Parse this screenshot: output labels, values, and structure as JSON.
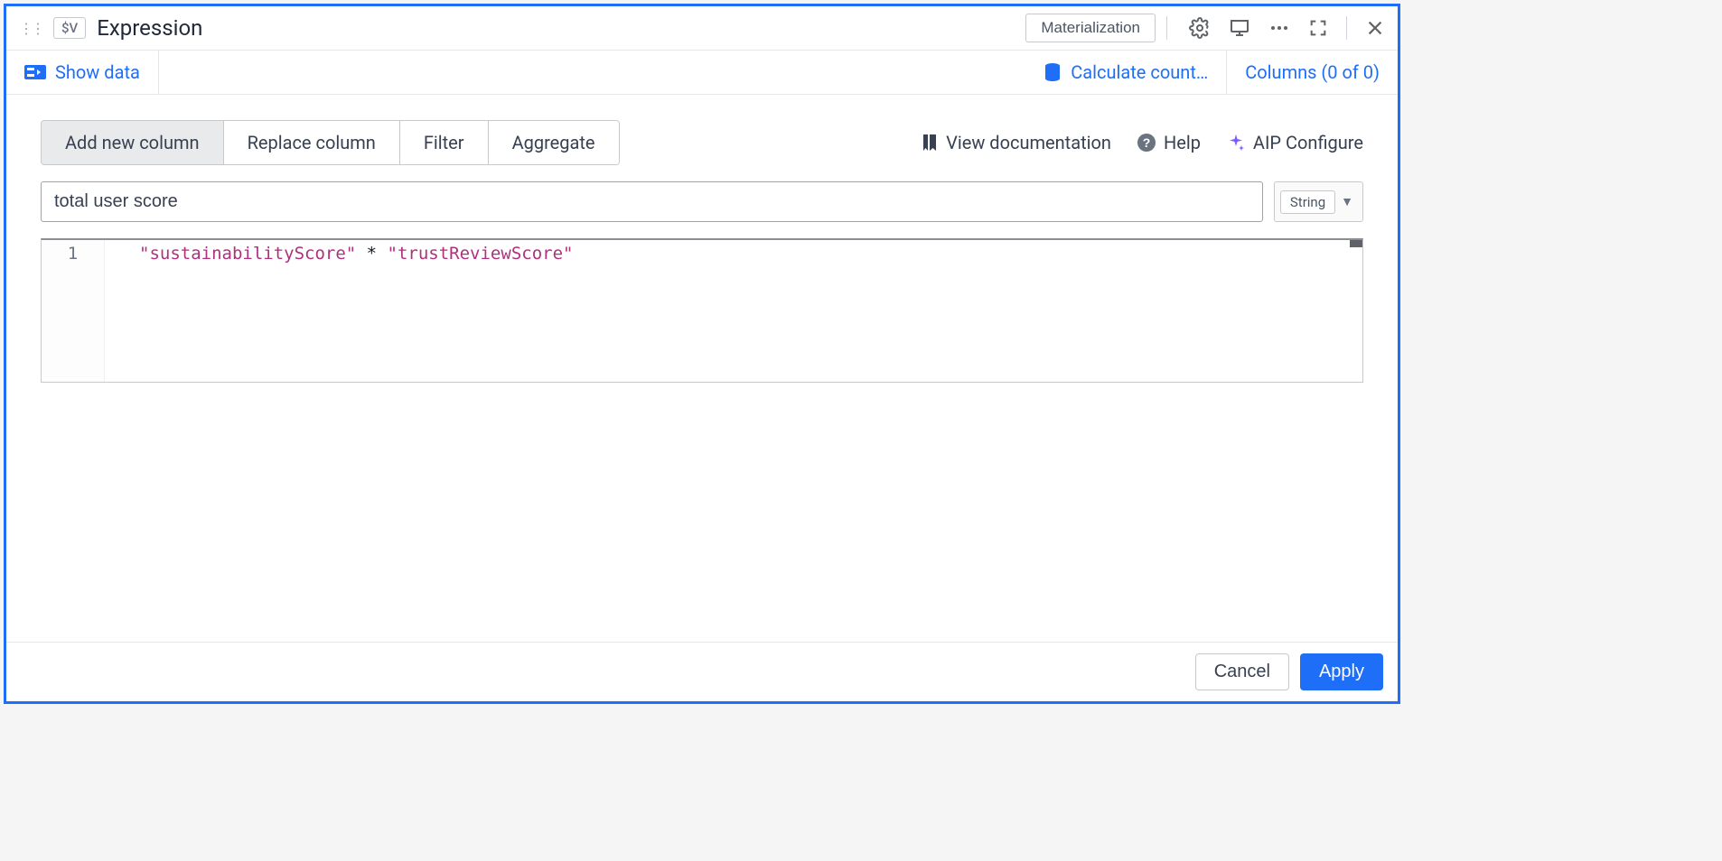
{
  "header": {
    "badge": "$V",
    "title": "Expression",
    "materialization_label": "Materialization"
  },
  "subheader": {
    "show_data_label": "Show data",
    "calc_count_label": "Calculate count…",
    "columns_label": "Columns (0 of 0)"
  },
  "tabs": {
    "add_new_column": "Add new column",
    "replace_column": "Replace column",
    "filter": "Filter",
    "aggregate": "Aggregate"
  },
  "helpers": {
    "view_docs": "View documentation",
    "help": "Help",
    "aip_configure": "AIP Configure"
  },
  "input": {
    "column_name": "total user score",
    "type_label": "String"
  },
  "editor": {
    "line_number": "1",
    "tokens": [
      {
        "t": "\"sustainabilityScore\"",
        "cls": "str"
      },
      {
        "t": " * ",
        "cls": "op"
      },
      {
        "t": "\"trustReviewScore\"",
        "cls": "str"
      }
    ]
  },
  "footer": {
    "cancel": "Cancel",
    "apply": "Apply"
  }
}
